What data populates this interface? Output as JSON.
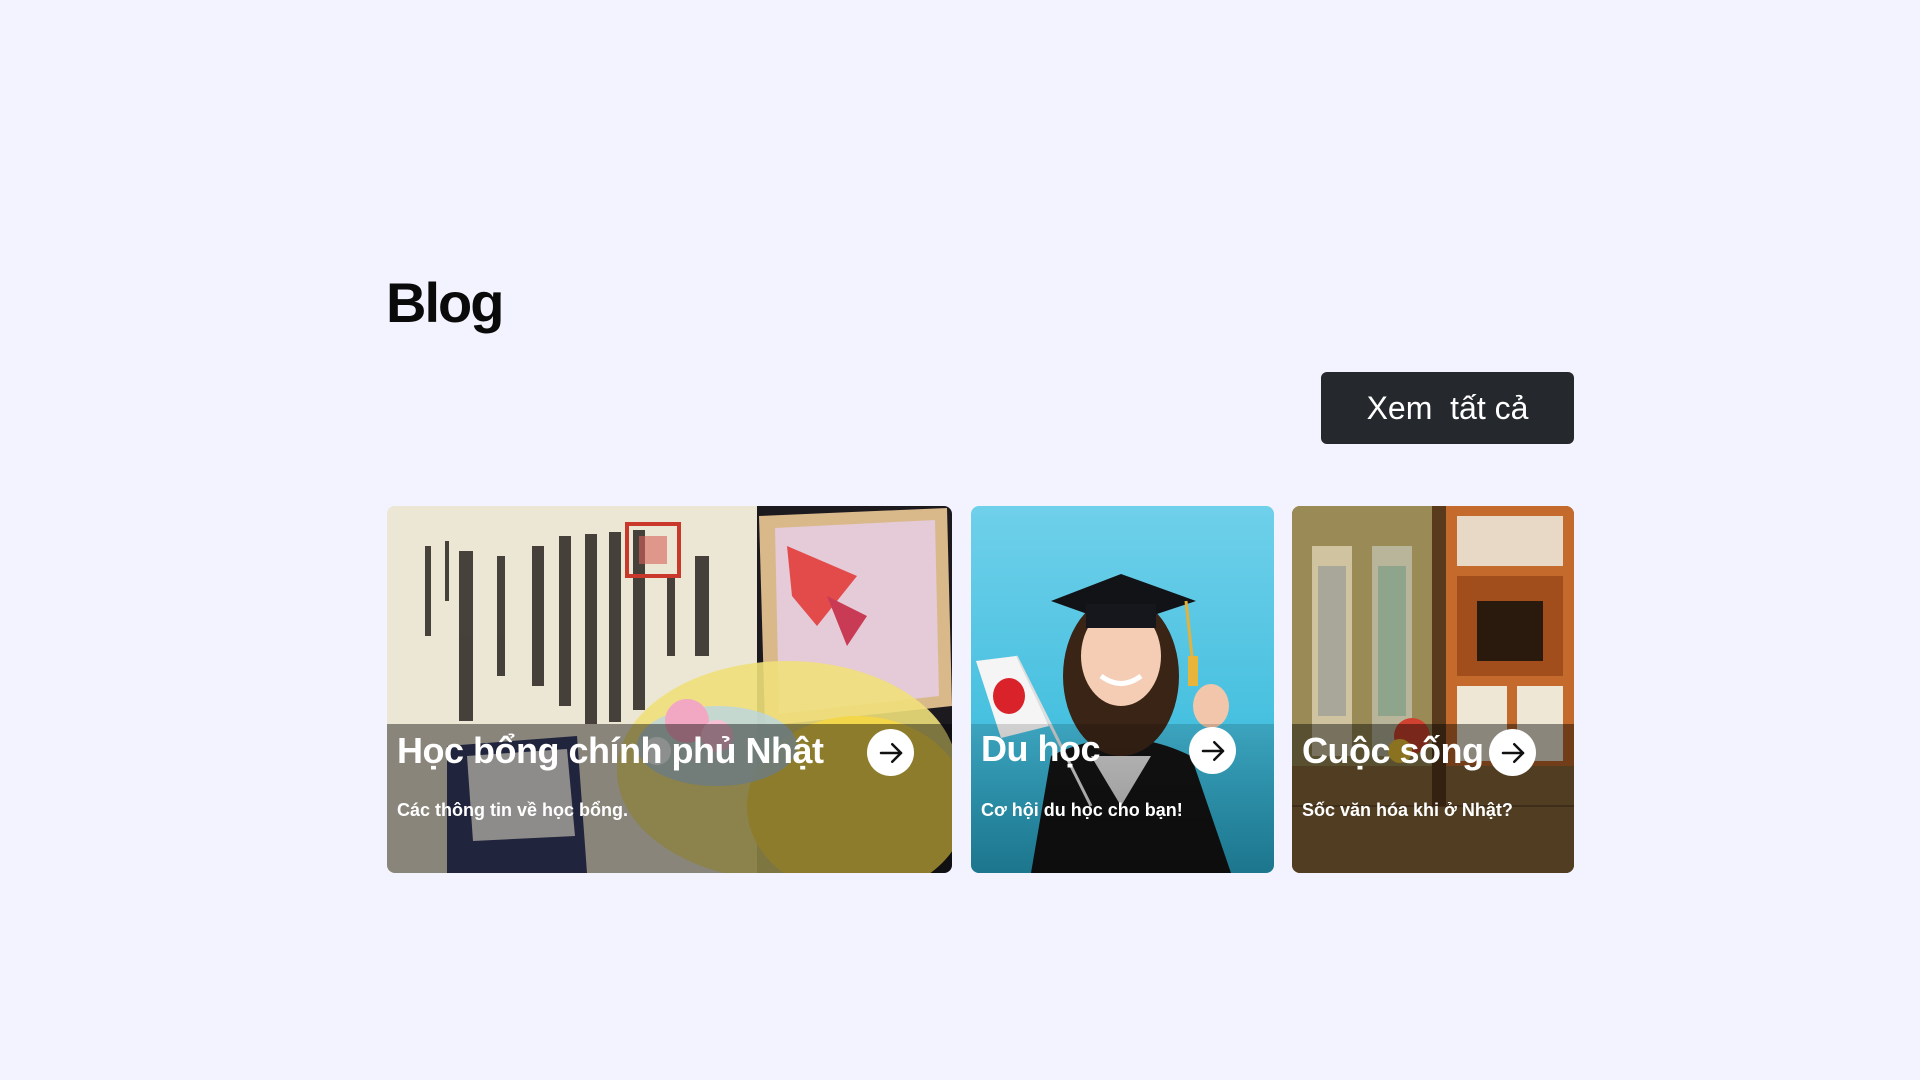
{
  "section": {
    "title": "Blog",
    "view_all_label": "Xem  tất cả"
  },
  "cards": [
    {
      "title": "Học bổng chính phủ Nhật",
      "description": "Các thông tin về học bổng.",
      "image": "certificate-flowers-photo"
    },
    {
      "title": "Du học",
      "description": "Cơ hội du học cho bạn!",
      "image": "graduate-student-photo"
    },
    {
      "title": "Cuộc sống",
      "description": "Sốc văn hóa khi ở Nhật?",
      "image": "japanese-room-photo"
    }
  ],
  "icons": {
    "card_arrow": "arrow-right-icon"
  },
  "colors": {
    "page_background": "#f2f3fe",
    "button_background": "#25282d",
    "button_text": "#ffffff"
  }
}
